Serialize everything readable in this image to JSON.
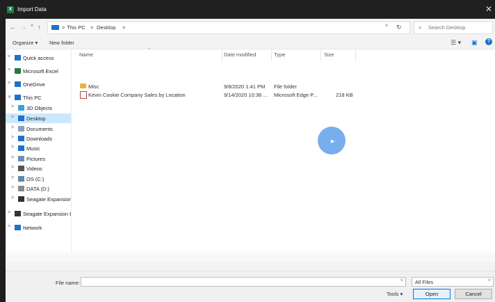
{
  "window": {
    "title": "Import Data",
    "close_icon": "close-icon"
  },
  "nav": {
    "back": "←",
    "forward": "→",
    "recent": "˅",
    "up": "↑",
    "breadcrumb": [
      "This PC",
      "Desktop"
    ],
    "separator": ">",
    "refresh": "↻",
    "search_placeholder": "Search Desktop"
  },
  "toolbar": {
    "organize": "Organize ▾",
    "new_folder": "New folder",
    "help": "?"
  },
  "sidebar": {
    "items": [
      {
        "label": "Quick access",
        "icon": "star-icon",
        "color": "#1c73c9"
      },
      {
        "label": "Microsoft Excel",
        "icon": "excel-icon",
        "color": "#1d7a45"
      },
      {
        "label": "OneDrive",
        "icon": "cloud-icon",
        "color": "#1c73c9"
      },
      {
        "label": "This PC",
        "icon": "computer-icon",
        "color": "#1c73c9"
      },
      {
        "label": "3D Objects",
        "icon": "cube-icon",
        "color": "#3aa0d8"
      },
      {
        "label": "Desktop",
        "icon": "desktop-icon",
        "color": "#1c73c9"
      },
      {
        "label": "Documents",
        "icon": "document-icon",
        "color": "#8aa0b8"
      },
      {
        "label": "Downloads",
        "icon": "download-icon",
        "color": "#1c73c9"
      },
      {
        "label": "Music",
        "icon": "music-icon",
        "color": "#1c73c9"
      },
      {
        "label": "Pictures",
        "icon": "picture-icon",
        "color": "#6a8fb5"
      },
      {
        "label": "Videos",
        "icon": "video-icon",
        "color": "#555555"
      },
      {
        "label": "OS (C:)",
        "icon": "drive-icon",
        "color": "#5a8ab0"
      },
      {
        "label": "DATA (D:)",
        "icon": "drive-icon",
        "color": "#888888"
      },
      {
        "label": "Seagate Expansion D",
        "icon": "external-drive-icon",
        "color": "#333333"
      },
      {
        "label": "Seagate Expansion Dr",
        "icon": "external-drive-icon",
        "color": "#333333"
      },
      {
        "label": "Network",
        "icon": "network-icon",
        "color": "#1c73c9"
      }
    ]
  },
  "columns": [
    "Name",
    "Date modified",
    "Type",
    "Size"
  ],
  "files": [
    {
      "name": "Misc",
      "date": "9/8/2020 1:41 PM",
      "type": "File folder",
      "size": "",
      "icon": "folder-icon"
    },
    {
      "name": "Kevin Cookie Company Sales by Location",
      "date": "9/14/2020 10:38 ...",
      "type": "Microsoft Edge P...",
      "size": "218 KB",
      "icon": "pdf-icon"
    }
  ],
  "footer": {
    "file_name_label": "File name:",
    "file_name_value": "",
    "file_type": "All Files",
    "tools": "Tools ▾",
    "open": "Open",
    "cancel": "Cancel"
  }
}
